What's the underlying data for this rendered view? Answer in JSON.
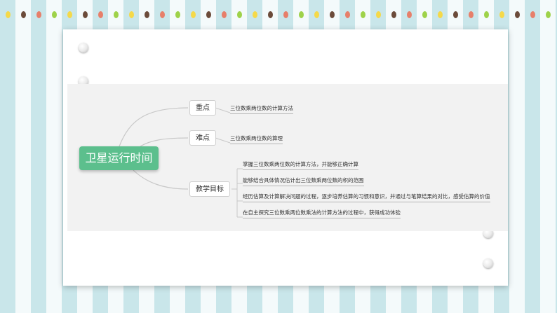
{
  "mindmap": {
    "root": "卫星运行时间",
    "branches": [
      {
        "label": "重点",
        "leaves": [
          "三位数乘两位数的计算方法"
        ]
      },
      {
        "label": "难点",
        "leaves": [
          "三位数乘两位数的算理"
        ]
      },
      {
        "label": "教学目标",
        "leaves": [
          "掌握三位数乘两位数的计算方法，并能够正确计算",
          "能够结合具体情况估计出三位数乘两位数的积的范围",
          "经历估算及计算解决问题的过程，逐步培养估算的习惯和意识，并通过与笔算结果的对比，感受估算的价值",
          "在自主探究三位数乘两位数乘法的计算方法的过程中，获得成功体验"
        ]
      }
    ]
  },
  "colors": {
    "root": "#5cbf8d",
    "dots": [
      "#f5d949",
      "#6b4b3a",
      "#e77f6a",
      "#9ed24a",
      "#f5d949",
      "#6b4b3a",
      "#e77f6a",
      "#9ed24a"
    ]
  }
}
